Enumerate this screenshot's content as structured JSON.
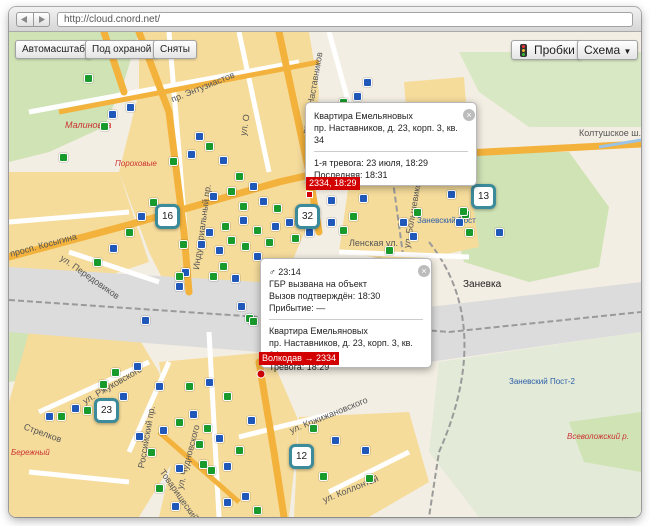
{
  "browser": {
    "url": "http://cloud.cnord.net/"
  },
  "toolbar": {
    "autoscale": "Автомасштаб",
    "guarded": "Под охраной",
    "removed": "Сняты",
    "traffic": "Пробки",
    "scheme": "Схема"
  },
  "streets": {
    "entuziastov": "пр. Энтузиастов",
    "nastavnikov": "просп. Наставников",
    "ul_o": "ул. О",
    "kosygina": "просп. Косыгина",
    "peredovikov": "ул. Передовиков",
    "industrialny": "Индустриальный пр.",
    "lenskaya": "Ленская ул.",
    "koltushskoe": "Колтушское ш.",
    "bolshevikov": "ул. Большевиков",
    "rossiysky": "Российский пр.",
    "chudnovskogo": "ул. Чудновского",
    "zhukovskogo": "ул. Ржуковского",
    "krzhizhanovskogo": "ул. Кржижановского",
    "kollontai": "ул. Коллонтай",
    "strelkov": "Стрелков",
    "tovarisheskiy": "Товарищеский",
    "vsevolozhsky": "Всеволожский р.",
    "beregovaya": "Бережный"
  },
  "districts": {
    "malinovka": "Малиновка",
    "porokhovye": "Пороховые",
    "zanevka": "Заневка",
    "zanevsky_post": "Заневский Пост",
    "zanevsky_post2": "Заневский Пост-2"
  },
  "clusters": [
    "16",
    "32",
    "13",
    "23",
    "12"
  ],
  "popup1": {
    "title": "Квартира Емельяновых",
    "address": "пр. Наставников, д. 23, корп. 3, кв. 34",
    "first_alarm": "1-я тревога: 23 июля, 18:29",
    "last": "Последняя: 18:31",
    "tag": "2334, 18:29"
  },
  "popup2": {
    "time": "♂ 23:14",
    "gbr": "ГБР вызвана на объект",
    "confirmed": "Вызов подтверждён: 18:30",
    "arrival": "Прибытие: —",
    "title": "Квартира Емельяновых",
    "address": "пр. Наставников, д. 23, корп. 3, кв. 34",
    "alarm": "Тревога: 18:29",
    "tag": "Волкодав → 2334"
  },
  "icons": {
    "back": "back-arrow-icon",
    "forward": "forward-arrow-icon",
    "traffic": "traffic-light-icon",
    "close": "close-icon",
    "dropdown": "chevron-down-icon"
  },
  "colors": {
    "marker_green": "#199a2c",
    "marker_blue": "#1f58b8",
    "alarm_red": "#d20000",
    "cluster_border": "#3b8b9b"
  }
}
